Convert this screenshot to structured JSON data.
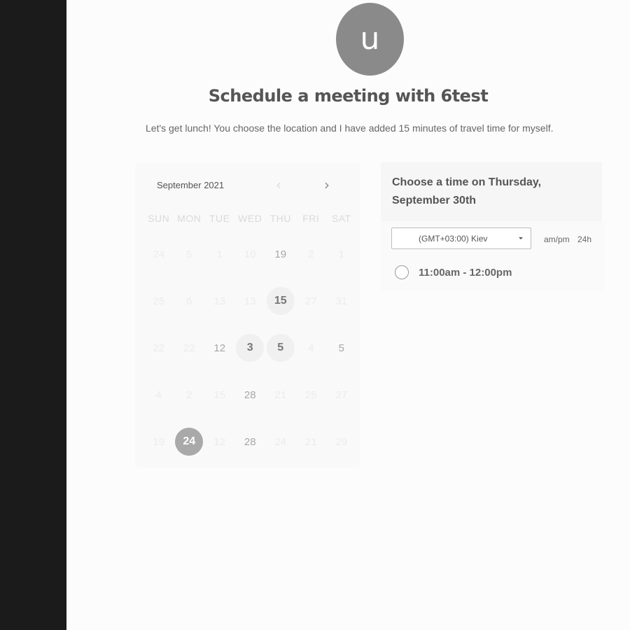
{
  "profile": {
    "initial": "u"
  },
  "header": {
    "title": "Schedule a meeting with 6test",
    "description": "Let's get lunch! You choose the location and I have added 15 minutes of travel time for myself."
  },
  "calendar": {
    "month": "September 2021",
    "prev_icon": "‹",
    "next_icon": "›",
    "weekdays": [
      "SUN",
      "MON",
      "TUE",
      "WED",
      "THU",
      "FRI",
      "SAT"
    ],
    "weeks": [
      [
        "24",
        "5",
        "1",
        "10",
        "19",
        "2",
        "1"
      ],
      [
        "25",
        "6",
        "13",
        "13",
        "15",
        "27",
        "31"
      ],
      [
        "22",
        "22",
        "12",
        "3",
        "5",
        "4",
        "5"
      ],
      [
        "4",
        "2",
        "15",
        "28",
        "21",
        "25",
        "27"
      ],
      [
        "19",
        "24",
        "12",
        "28",
        "24",
        "21",
        "29"
      ]
    ],
    "selected_day": "24",
    "available_days": [
      "15",
      "3",
      "5"
    ]
  },
  "panel": {
    "title": "Choose a time on Thursday, September 30th",
    "timezone": "(GMT+03:00) Kiev",
    "format_ampm": "am/pm",
    "format_24h": "24h",
    "slots": [
      "11:00am - 12:00pm"
    ]
  }
}
